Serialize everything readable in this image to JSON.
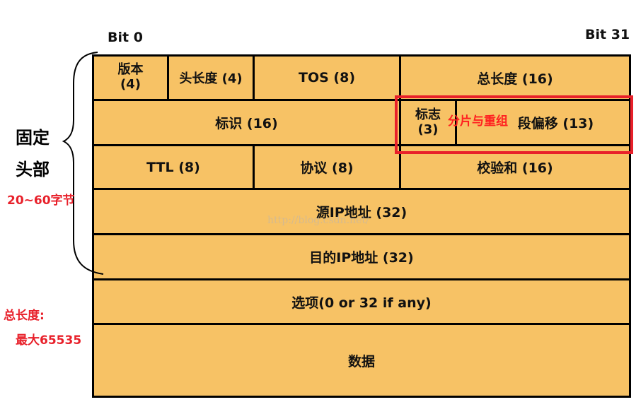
{
  "bits": {
    "start": "Bit 0",
    "end": "Bit 31"
  },
  "side_labels": {
    "fixed_line1": "固定",
    "fixed_line2": "头部",
    "fixed_size": "20~60字节",
    "total_length_note_line1": "总长度:",
    "total_length_note_line2": "最大65535"
  },
  "fields": {
    "version_line1": "版本",
    "version_line2": "(4)",
    "header_length": "头长度 (4)",
    "tos": "TOS (8)",
    "total_length": "总长度 (16)",
    "identification": "标识 (16)",
    "flags_line1": "标志",
    "flags_line2": "(3)",
    "fragment_offset": "段偏移 (13)",
    "ttl": "TTL (8)",
    "protocol": "协议 (8)",
    "checksum": "校验和 (16)",
    "source_ip": "源IP地址 (32)",
    "dest_ip": "目的IP地址 (32)",
    "options": "选项(0 or 32 if any)",
    "data": "数据"
  },
  "annotation": {
    "fragmentation": "分片与重组"
  },
  "watermark": "http://blog.csdn.net/"
}
